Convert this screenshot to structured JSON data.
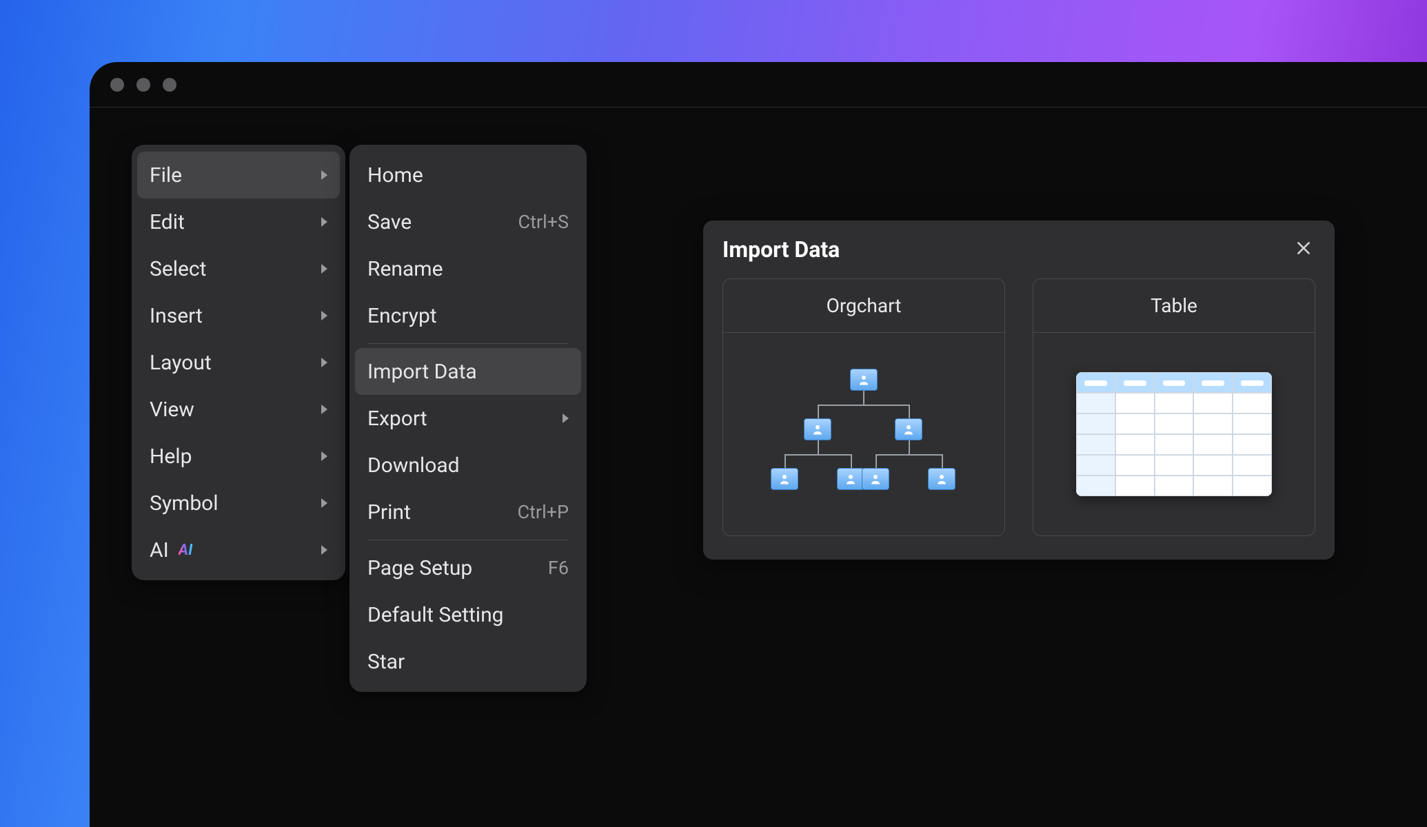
{
  "menubar": {
    "items": [
      {
        "label": "File",
        "has_submenu": true,
        "highlight": true
      },
      {
        "label": "Edit",
        "has_submenu": true
      },
      {
        "label": "Select",
        "has_submenu": true
      },
      {
        "label": "Insert",
        "has_submenu": true
      },
      {
        "label": "Layout",
        "has_submenu": true
      },
      {
        "label": "View",
        "has_submenu": true
      },
      {
        "label": "Help",
        "has_submenu": true
      },
      {
        "label": "Symbol",
        "has_submenu": true
      },
      {
        "label": "AI",
        "has_submenu": true,
        "badge": "AI"
      }
    ]
  },
  "file_menu": {
    "groups": [
      [
        {
          "label": "Home"
        },
        {
          "label": "Save",
          "shortcut": "Ctrl+S"
        },
        {
          "label": "Rename"
        },
        {
          "label": "Encrypt"
        }
      ],
      [
        {
          "label": "Import Data",
          "highlight": true
        },
        {
          "label": "Export",
          "has_submenu": true
        },
        {
          "label": "Download"
        },
        {
          "label": "Print",
          "shortcut": "Ctrl+P"
        }
      ],
      [
        {
          "label": "Page Setup",
          "shortcut": "F6"
        },
        {
          "label": "Default Setting"
        },
        {
          "label": "Star"
        }
      ]
    ]
  },
  "panel": {
    "title": "Import Data",
    "cards": [
      {
        "label": "Orgchart"
      },
      {
        "label": "Table"
      }
    ]
  }
}
